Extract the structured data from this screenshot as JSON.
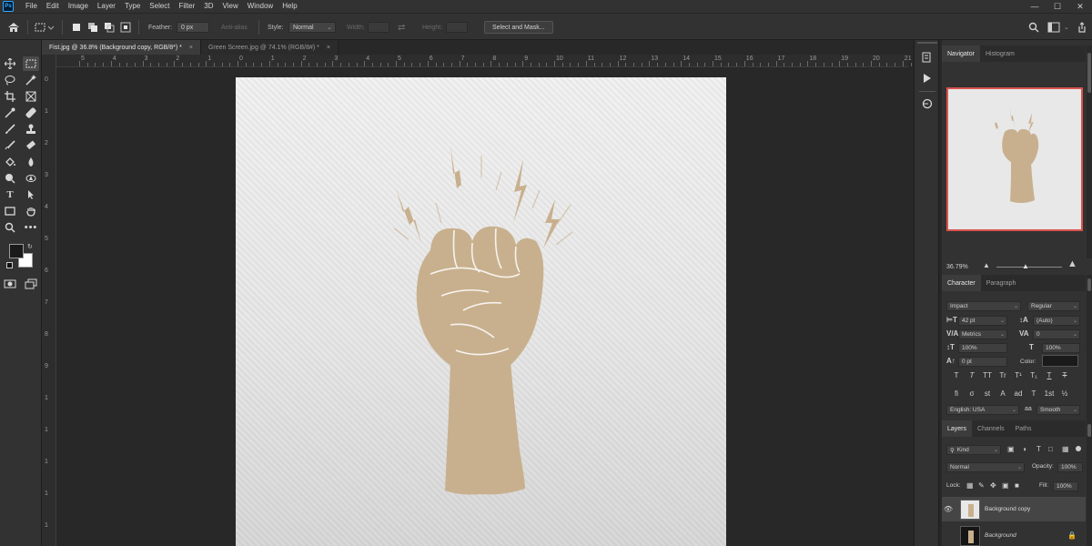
{
  "app": {
    "logo": "Ps"
  },
  "menubar": {
    "items": [
      "File",
      "Edit",
      "Image",
      "Layer",
      "Type",
      "Select",
      "Filter",
      "3D",
      "View",
      "Window",
      "Help"
    ],
    "window_controls": {
      "minimize": "—",
      "maximize": "☐",
      "close": "✕"
    }
  },
  "options": {
    "feather_label": "Feather:",
    "feather_value": "0 px",
    "antialias_label": "Anti-alias",
    "style_label": "Style:",
    "style_value": "Normal",
    "width_label": "Width:",
    "height_label": "Height:",
    "select_mask_button": "Select and Mask..."
  },
  "tabs": [
    {
      "label": "Fist.jpg @ 36.8% (Background copy, RGB/8*) *",
      "close": "×",
      "active": true
    },
    {
      "label": "Green Screen.jpg @ 74.1% (RGB/8#) *",
      "close": "×",
      "active": false
    }
  ],
  "ruler": {
    "top": [
      "5",
      "4",
      "3",
      "2",
      "1",
      "0",
      "1",
      "2",
      "3",
      "4",
      "5",
      "6",
      "7",
      "8",
      "9",
      "10",
      "11",
      "12",
      "13",
      "14",
      "15",
      "16",
      "17",
      "18",
      "19",
      "20",
      "21"
    ],
    "left": [
      "0",
      "1",
      "2",
      "3",
      "4",
      "5",
      "6",
      "7",
      "8",
      "9",
      "1",
      "1",
      "1",
      "1",
      "1"
    ]
  },
  "navigator": {
    "tabs": [
      "Navigator",
      "Histogram"
    ],
    "zoom": "36.79%"
  },
  "character": {
    "tabs": [
      "Character",
      "Paragraph"
    ],
    "font_family": "Impact",
    "font_style": "Regular",
    "font_size": "42 pt",
    "leading": "(Auto)",
    "kerning": "Metrics",
    "tracking": "0",
    "vertical_scale": "100%",
    "horizontal_scale": "100%",
    "baseline_shift": "0 pt",
    "color_label": "Color:",
    "style_buttons": [
      "T",
      "T",
      "TT",
      "Tr",
      "T¹",
      "T₁",
      "T",
      "T"
    ],
    "opentype_buttons": [
      "fi",
      "σ",
      "st",
      "A",
      "ad",
      "T",
      "1st",
      "½"
    ],
    "language": "English: USA",
    "antialias": "Smooth"
  },
  "layers": {
    "tabs": [
      "Layers",
      "Channels",
      "Paths"
    ],
    "filter_kind": "Kind",
    "blend_mode": "Normal",
    "opacity_label": "Opacity:",
    "opacity_value": "100%",
    "lock_label": "Lock:",
    "fill_label": "Fill:",
    "fill_value": "100%",
    "items": [
      {
        "name": "Background copy",
        "visible": true,
        "active": true
      },
      {
        "name": "Background",
        "visible": false,
        "active": false
      }
    ]
  },
  "colors": {
    "foreground": "#1a1a1a",
    "background": "#ffffff",
    "fist": "#c8b08e",
    "active_tab": "#3b3b3b",
    "navigator_frame": "#d9534f"
  }
}
